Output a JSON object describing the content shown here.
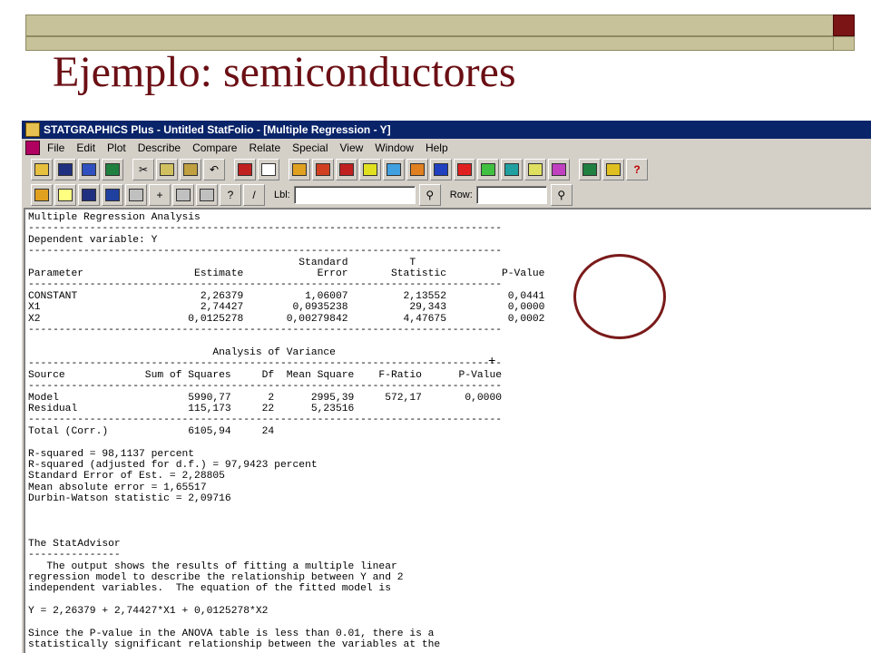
{
  "slide": {
    "title": "Ejemplo: semiconductores"
  },
  "window": {
    "title": "STATGRAPHICS Plus - Untitled StatFolio - [Multiple Regression - Y]"
  },
  "menu": [
    "File",
    "Edit",
    "Plot",
    "Describe",
    "Compare",
    "Relate",
    "Special",
    "View",
    "Window",
    "Help"
  ],
  "toolbar2": {
    "lbl_label": "Lbl:",
    "row_label": "Row:"
  },
  "output": {
    "lines": [
      "Multiple Regression Analysis",
      "-----------------------------------------------------------------------------",
      "Dependent variable: Y",
      "-----------------------------------------------------------------------------",
      "                                            Standard          T",
      "Parameter                  Estimate            Error       Statistic         P-Value",
      "-----------------------------------------------------------------------------",
      "CONSTANT                    2,26379          1,06007         2,13552          0,0441",
      "X1                          2,74427        0,0935238          29,343          0,0000",
      "X2                        0,0125278       0,00279842         4,47675          0,0002",
      "-----------------------------------------------------------------------------",
      "",
      "                              Analysis of Variance",
      "-----------------------------------------------------------------------------",
      "Source             Sum of Squares     Df  Mean Square    F-Ratio      P-Value",
      "-----------------------------------------------------------------------------",
      "Model                     5990,77      2      2995,39     572,17       0,0000",
      "Residual                  115,173     22      5,23516",
      "-----------------------------------------------------------------------------",
      "Total (Corr.)             6105,94     24",
      "",
      "R-squared = 98,1137 percent",
      "R-squared (adjusted for d.f.) = 97,9423 percent",
      "Standard Error of Est. = 2,28805",
      "Mean absolute error = 1,65517",
      "Durbin-Watson statistic = 2,09716",
      "",
      "",
      "",
      "The StatAdvisor",
      "---------------",
      "   The output shows the results of fitting a multiple linear",
      "regression model to describe the relationship between Y and 2",
      "independent variables.  The equation of the fitted model is",
      "",
      "Y = 2,26379 + 2,74427*X1 + 0,0125278*X2",
      "",
      "Since the P-value in the ANOVA table is less than 0.01, there is a",
      "statistically significant relationship between the variables at the"
    ]
  },
  "colors": {
    "accent": "#6b0f14",
    "titlebar": "#0a246a",
    "circle": "#7a1a1a"
  }
}
